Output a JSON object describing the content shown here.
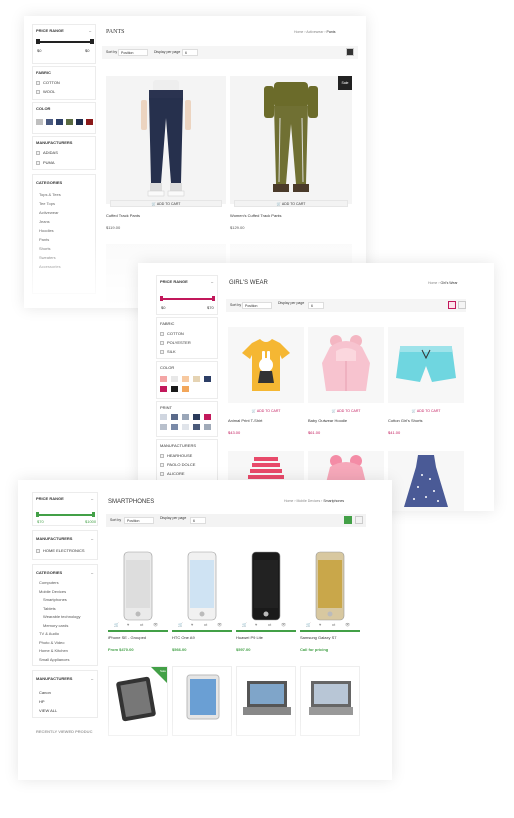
{
  "colors": {
    "accent_pants": "#333333",
    "accent_girls": "#c2185b",
    "accent_phones": "#43a047",
    "price_green": "#43a047",
    "price_red": "#c2185b"
  },
  "pants": {
    "title": "PANTS",
    "breadcrumb": [
      "Home",
      "Activewear",
      "Pants"
    ],
    "sort_label": "Sort by",
    "sort_value": "Position",
    "display_label": "Display per page",
    "display_value": "6",
    "price_range": "PRICE RANGE",
    "price_min": "$0",
    "price_max": "$0",
    "fabric_title": "FABRIC",
    "fabrics": [
      "COTTON",
      "WOOL"
    ],
    "color_title": "COLOR",
    "swatches": [
      "#bfbfbf",
      "#4a5a80",
      "#2c3e66",
      "#5a6a40",
      "#1f2d4d",
      "#8b1a1a"
    ],
    "manufacturers_title": "MANUFACTURERS",
    "manufacturers": [
      "ADIDAS",
      "PUMA"
    ],
    "categories_title": "CATEGORIES",
    "categories": [
      "Tops & Tees",
      "Tee Tops",
      "Activewear",
      "Jeans",
      "Hoodies",
      "Pants",
      "Shorts",
      "Sweaters",
      "Accessories"
    ],
    "add_to_cart": "ADD TO CART",
    "products": [
      {
        "name": "Cuffed Track Pants",
        "price": "$119.00",
        "badge": ""
      },
      {
        "name": "Women's Cuffed Track Pants",
        "price": "$129.00",
        "badge": "Sale"
      }
    ]
  },
  "girls": {
    "title": "GIRL'S WEAR",
    "breadcrumb": [
      "Home",
      "Girl's Wear"
    ],
    "sort_label": "Sort by",
    "sort_value": "Position",
    "display_label": "Display per page",
    "display_value": "6",
    "price_range": "PRICE RANGE",
    "price_min": "$0",
    "price_max": "$70",
    "fabric_title": "FABRIC",
    "fabrics": [
      "COTTON",
      "POLYESTER",
      "SILK"
    ],
    "color_title": "COLOR",
    "swatches": [
      "#f4a6a6",
      "#e8e8e8",
      "#f7c9a0",
      "#e5d3b3",
      "#2c3e66",
      "#c2185b",
      "#1a1a1a",
      "#f2a65a"
    ],
    "print_title": "PRINT",
    "manufacturers_title": "MANUFACTURERS",
    "manufacturers": [
      "HEARHOUSE",
      "PAOLO DOLCE",
      "ALICORE"
    ],
    "add_to_cart": "ADD TO CART",
    "products": [
      {
        "name": "Animal Print T-Shirt",
        "price": "$43.00"
      },
      {
        "name": "Baby Outwear Hoodie",
        "price": "$61.00"
      },
      {
        "name": "Cotton Girl's Shorts",
        "price": "$41.00"
      }
    ]
  },
  "phones": {
    "title": "SMARTPHONES",
    "breadcrumb": [
      "Home",
      "Mobile Devices",
      "Smartphones"
    ],
    "sort_label": "Sort by",
    "sort_value": "Position",
    "display_label": "Display per page",
    "display_value": "6",
    "price_range": "PRICE RANGE",
    "price_min": "$70",
    "price_max": "$1000",
    "manufacturers_title": "MANUFACTURERS",
    "manufacturers_item": "HOME ELECTRONICS",
    "categories_title": "CATEGORIES",
    "categories": [
      "Computers",
      "Mobile Devices",
      "Smartphones",
      "Tablets",
      "Wearable technology",
      "Memory cards",
      "TV & Audio",
      "Photo & Video",
      "Home & Kitchen",
      "Small Appliances"
    ],
    "manufacturers2_title": "MANUFACTURERS",
    "manufacturers2": [
      "Canon",
      "HP"
    ],
    "view_all": "VIEW ALL",
    "recently_viewed": "RECENTLY VIEWED PRODUC",
    "products": [
      {
        "name": "iPhone SE - Grouped",
        "price": "From $470.00"
      },
      {
        "name": "HTC One A9",
        "price": "$566.00"
      },
      {
        "name": "Huawei P9 Lite",
        "price": "$597.00"
      },
      {
        "name": "Samsung Galaxy S7",
        "price": "Call for pricing"
      }
    ],
    "sale_badge": "Sale"
  }
}
